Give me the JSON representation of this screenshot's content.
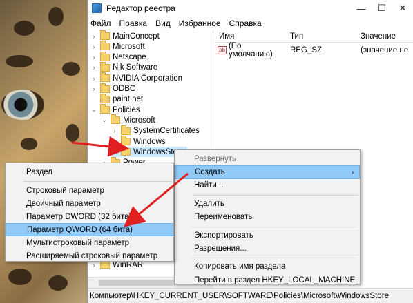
{
  "window": {
    "title": "Редактор реестра",
    "controls": [
      "—",
      "☐",
      "✕"
    ]
  },
  "menubar": [
    "Файл",
    "Правка",
    "Вид",
    "Избранное",
    "Справка"
  ],
  "tree": [
    {
      "label": "MainConcept",
      "chevron": "›",
      "level": 0
    },
    {
      "label": "Microsoft",
      "chevron": "›",
      "level": 0
    },
    {
      "label": "Netscape",
      "chevron": "›",
      "level": 0
    },
    {
      "label": "Nik Software",
      "chevron": "›",
      "level": 0
    },
    {
      "label": "NVIDIA Corporation",
      "chevron": "›",
      "level": 0
    },
    {
      "label": "ODBC",
      "chevron": "›",
      "level": 0
    },
    {
      "label": "paint.net",
      "chevron": "",
      "level": 0
    },
    {
      "label": "Policies",
      "chevron": "⌄",
      "level": 0
    },
    {
      "label": "Microsoft",
      "chevron": "⌄",
      "level": 1
    },
    {
      "label": "SystemCertificates",
      "chevron": "›",
      "level": 2
    },
    {
      "label": "Windows",
      "chevron": "›",
      "level": 2
    },
    {
      "label": "WindowsStore",
      "chevron": "",
      "level": 2,
      "selected": true
    },
    {
      "label": "Power",
      "chevron": "›",
      "level": 1
    }
  ],
  "tree_bottom": {
    "label": "WinRAR",
    "chevron": "›"
  },
  "list": {
    "headers": {
      "name": "Имя",
      "type": "Тип",
      "value": "Значение"
    },
    "rows": [
      {
        "name": "(По умолчанию)",
        "type": "REG_SZ",
        "value": "(значение не"
      }
    ]
  },
  "status": "Компьютер\\HKEY_CURRENT_USER\\SOFTWARE\\Policies\\Microsoft\\WindowsStore",
  "context_menu": {
    "items": [
      {
        "label": "Развернуть",
        "disabled": true
      },
      {
        "label": "Создать",
        "highlight": true,
        "submenu": "›"
      },
      {
        "label": "Найти..."
      },
      {
        "sep": true
      },
      {
        "label": "Удалить"
      },
      {
        "label": "Переименовать"
      },
      {
        "sep": true
      },
      {
        "label": "Экспортировать"
      },
      {
        "label": "Разрешения..."
      },
      {
        "sep": true
      },
      {
        "label": "Копировать имя раздела"
      },
      {
        "label": "Перейти в раздел HKEY_LOCAL_MACHINE"
      }
    ]
  },
  "submenu": {
    "items": [
      {
        "label": "Раздел"
      },
      {
        "sep": true
      },
      {
        "label": "Строковый параметр"
      },
      {
        "label": "Двоичный параметр"
      },
      {
        "label": "Параметр DWORD (32 бита)"
      },
      {
        "label": "Параметр QWORD (64 бита)",
        "highlight": true
      },
      {
        "label": "Мультистроковый параметр"
      },
      {
        "label": "Расширяемый строковый параметр"
      }
    ]
  },
  "colors": {
    "accent_arrow": "#e02020",
    "highlight": "#91c9f7",
    "selection": "#cce8ff"
  },
  "icons": {
    "app": "regedit-icon",
    "folder": "folder-icon",
    "value": "string-value-icon"
  }
}
